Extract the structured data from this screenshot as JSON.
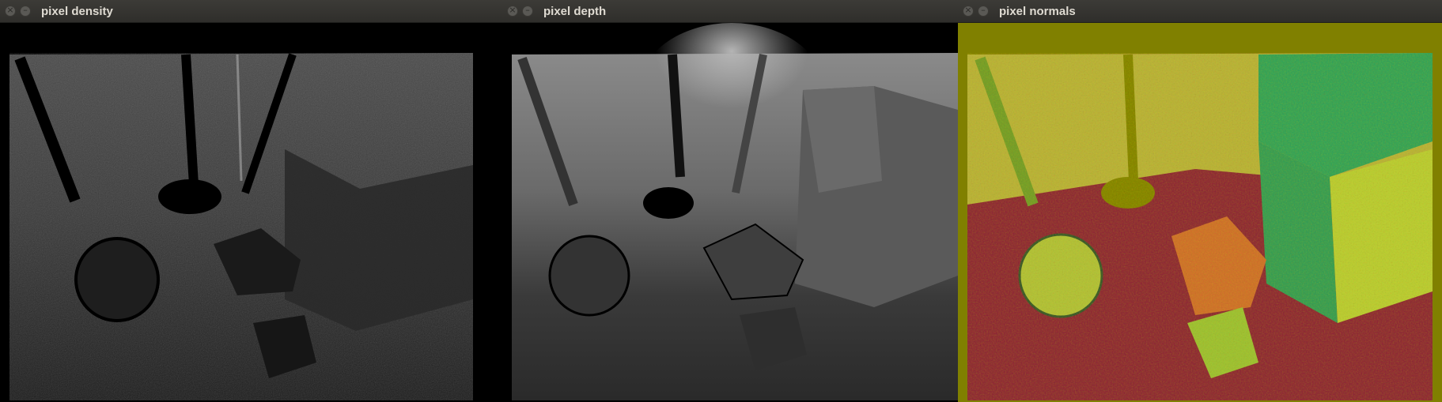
{
  "windows": [
    {
      "title": "pixel density",
      "close_glyph": "×",
      "minimize_glyph": "–"
    },
    {
      "title": "pixel depth",
      "close_glyph": "×",
      "minimize_glyph": "–"
    },
    {
      "title": "pixel normals",
      "close_glyph": "×",
      "minimize_glyph": "–"
    }
  ],
  "icons": {
    "close": "close-icon",
    "minimize": "minimize-icon"
  },
  "colors": {
    "titlebar": "#3c3b37",
    "title_text": "#dfdbd2",
    "normals_background": "#808000",
    "normals_floor": "#8a1e3a",
    "normals_wall": "#b8b040",
    "normals_box": "#2aa060"
  }
}
